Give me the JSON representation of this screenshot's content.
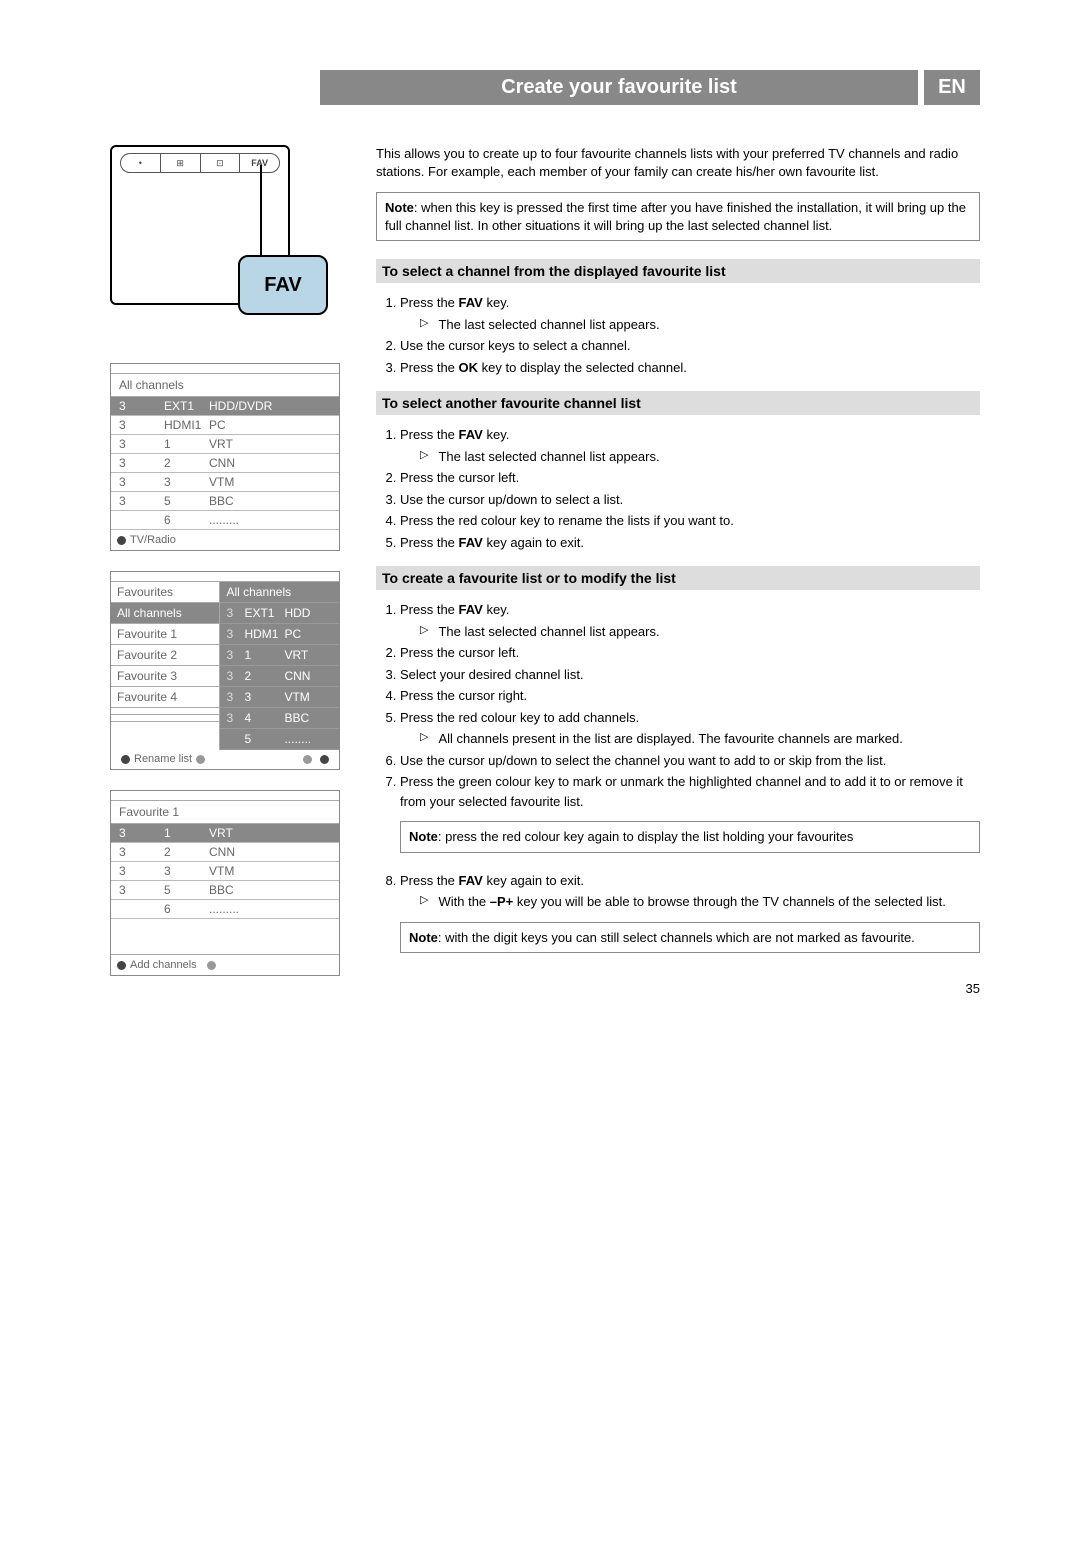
{
  "header": {
    "title": "Create your favourite list",
    "lang": "EN"
  },
  "tv": {
    "fav_icon_label": "FAV",
    "fav_callout": "FAV",
    "top_slots": [
      "•",
      "⊞",
      "⊡",
      "FAV"
    ]
  },
  "osd1": {
    "title": "All channels",
    "rows": [
      {
        "n": "3",
        "ch": "EXT1",
        "name": "HDD/DVDR",
        "hi": true
      },
      {
        "n": "3",
        "ch": "HDMI1",
        "name": "PC",
        "hi": false
      },
      {
        "n": "3",
        "ch": "1",
        "name": "VRT",
        "hi": false
      },
      {
        "n": "3",
        "ch": "2",
        "name": "CNN",
        "hi": false
      },
      {
        "n": "3",
        "ch": "3",
        "name": "VTM",
        "hi": false
      },
      {
        "n": "3",
        "ch": "5",
        "name": "BBC",
        "hi": false
      },
      {
        "n": "",
        "ch": "6",
        "name": ".........",
        "hi": false
      }
    ],
    "footer": "TV/Radio"
  },
  "osd2": {
    "left_header": "Favourites",
    "right_header": "All channels",
    "left_items": [
      "All channels",
      "Favourite 1",
      "Favourite 2",
      "Favourite 3",
      "Favourite 4",
      "",
      ""
    ],
    "right_rows": [
      {
        "p": "3",
        "ch": "EXT1",
        "name": "HDD"
      },
      {
        "p": "3",
        "ch": "HDM1",
        "name": "PC"
      },
      {
        "p": "3",
        "ch": "1",
        "name": "VRT"
      },
      {
        "p": "3",
        "ch": "2",
        "name": "CNN"
      },
      {
        "p": "3",
        "ch": "3",
        "name": "VTM"
      },
      {
        "p": "3",
        "ch": "4",
        "name": "BBC"
      },
      {
        "p": "",
        "ch": "5",
        "name": "........"
      }
    ],
    "footer_left": "Rename list"
  },
  "osd3": {
    "title": "Favourite 1",
    "rows": [
      {
        "n": "3",
        "ch": "1",
        "name": "VRT",
        "hi": true
      },
      {
        "n": "3",
        "ch": "2",
        "name": "CNN",
        "hi": false
      },
      {
        "n": "3",
        "ch": "3",
        "name": "VTM",
        "hi": false
      },
      {
        "n": "3",
        "ch": "5",
        "name": "BBC",
        "hi": false
      },
      {
        "n": "",
        "ch": "6",
        "name": ".........",
        "hi": false
      }
    ],
    "footer": "Add channels"
  },
  "intro": "This allows you to create up to four favourite channels lists with your preferred TV channels and radio stations. For example, each member of your family can create his/her own favourite list.",
  "note1_label": "Note",
  "note1": ": when this key is pressed the first time after you have finished the installation, it will bring up the full channel list. In other situations it will bring up the last selected channel list.",
  "sections": {
    "s1": {
      "title": "To select a channel from the displayed favourite list",
      "step1": "Press the ",
      "step1b": "FAV",
      "step1c": " key.",
      "sub1": "The last selected channel list appears.",
      "step2": "Use the cursor keys to select a channel.",
      "step3a": "Press the ",
      "step3b": "OK",
      "step3c": " key to display the selected channel."
    },
    "s2": {
      "title": "To select another favourite channel list",
      "step1a": "Press the ",
      "step1b": "FAV",
      "step1c": " key.",
      "sub1": "The last selected channel list appears.",
      "step2": "Press the cursor left.",
      "step3": "Use the cursor up/down to select a list.",
      "step4": "Press the red colour key to rename the lists if you want to.",
      "step5a": "Press the ",
      "step5b": "FAV",
      "step5c": " key again to exit."
    },
    "s3": {
      "title": "To create a favourite list or to modify the list",
      "step1a": "Press the ",
      "step1b": "FAV",
      "step1c": " key.",
      "sub1": "The last selected channel list appears.",
      "step2": "Press the cursor left.",
      "step3": "Select your desired channel list.",
      "step4": "Press the cursor right.",
      "step5": "Press the red colour key to add channels.",
      "sub5": "All channels present in the list are displayed. The favourite channels are marked.",
      "step6": "Use the cursor up/down to select the channel you want to add to or skip from the list.",
      "step7": "Press the green colour key to mark or unmark the highlighted channel and to add it to or remove it from your selected favourite list.",
      "note2_label": "Note",
      "note2": ": press the red colour key again to display the list holding your favourites",
      "step8a": "Press the ",
      "step8b": "FAV",
      "step8c": " key again to exit.",
      "sub8a": "With the ",
      "sub8b": "–P+",
      "sub8c": " key you will be able to browse through the TV channels of the selected list.",
      "note3_label": "Note",
      "note3": ": with the digit keys you can still select channels which are not marked as favourite."
    }
  },
  "pagenum": "35"
}
